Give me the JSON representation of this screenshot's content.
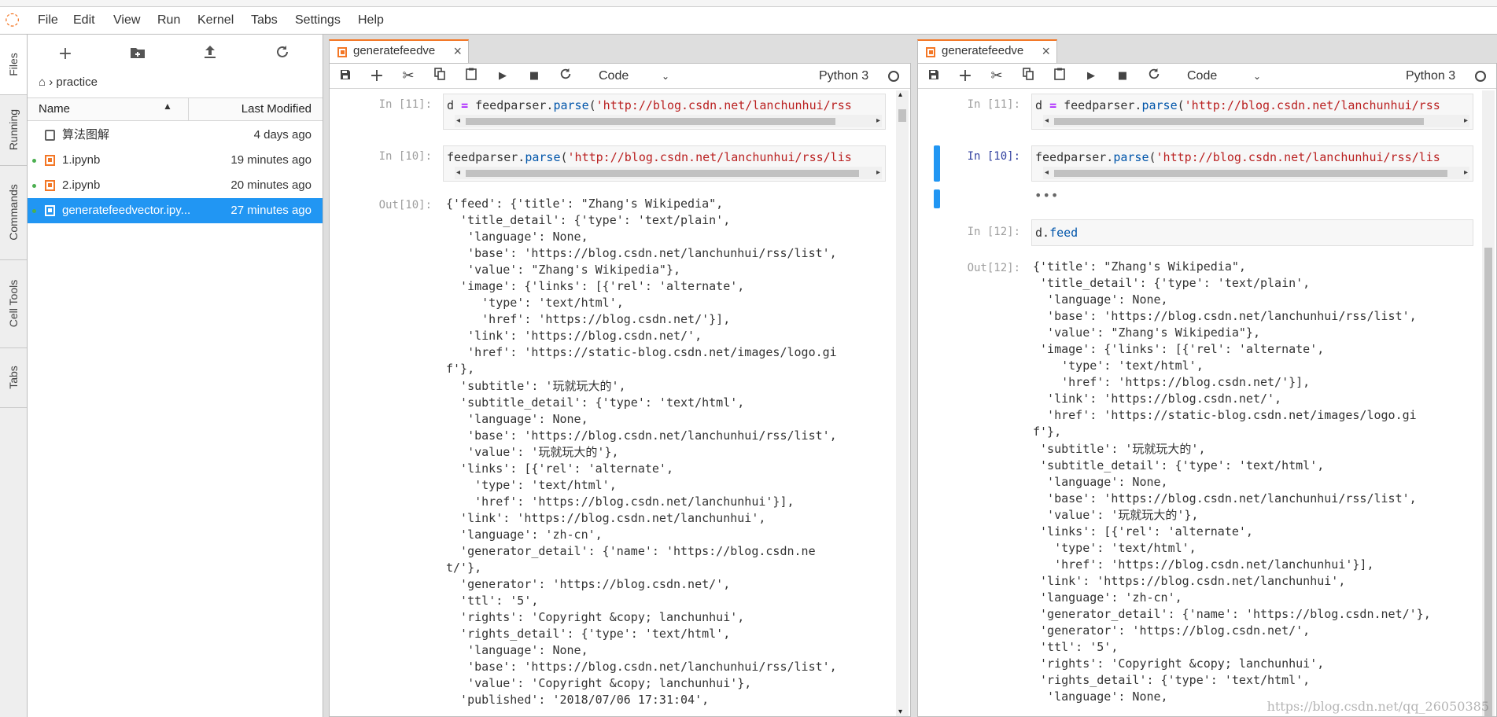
{
  "menubar": {
    "items": [
      "File",
      "Edit",
      "View",
      "Run",
      "Kernel",
      "Tabs",
      "Settings",
      "Help"
    ]
  },
  "left_tabs": [
    "Files",
    "Running",
    "Commands",
    "Cell Tools",
    "Tabs"
  ],
  "filebrowser": {
    "breadcrumb": "practice",
    "col_name": "Name",
    "col_modified": "Last Modified",
    "files": [
      {
        "name": "算法图解",
        "modified": "4 days ago",
        "type": "folder",
        "running": false,
        "selected": false
      },
      {
        "name": "1.ipynb",
        "modified": "19 minutes ago",
        "type": "notebook",
        "running": true,
        "selected": false
      },
      {
        "name": "2.ipynb",
        "modified": "20 minutes ago",
        "type": "notebook",
        "running": true,
        "selected": false
      },
      {
        "name": "generatefeedvector.ipy...",
        "modified": "27 minutes ago",
        "type": "notebook",
        "running": true,
        "selected": true
      }
    ]
  },
  "notebooks": [
    {
      "tab_label": "generatefeedve",
      "cell_type": "Code",
      "kernel": "Python 3",
      "cells": [
        {
          "prompt": "In [11]:",
          "code_parts": [
            "d ",
            "=",
            " feedparser.",
            "parse",
            "(",
            "'http://blog.csdn.net/lanchunhui/rss"
          ]
        },
        {
          "prompt": "In [10]:",
          "code_parts": [
            "feedparser.",
            "parse",
            "(",
            "'http://blog.csdn.net/lanchunhui/rss/lis"
          ]
        }
      ],
      "out_prompt": "Out[10]:",
      "output": "{'feed': {'title': \"Zhang's Wikipedia\",\n  'title_detail': {'type': 'text/plain',\n   'language': None,\n   'base': 'https://blog.csdn.net/lanchunhui/rss/list',\n   'value': \"Zhang's Wikipedia\"},\n  'image': {'links': [{'rel': 'alternate',\n     'type': 'text/html',\n     'href': 'https://blog.csdn.net/'}],\n   'link': 'https://blog.csdn.net/',\n   'href': 'https://static-blog.csdn.net/images/logo.gi\nf'},\n  'subtitle': '玩就玩大的',\n  'subtitle_detail': {'type': 'text/html',\n   'language': None,\n   'base': 'https://blog.csdn.net/lanchunhui/rss/list',\n   'value': '玩就玩大的'},\n  'links': [{'rel': 'alternate',\n    'type': 'text/html',\n    'href': 'https://blog.csdn.net/lanchunhui'}],\n  'link': 'https://blog.csdn.net/lanchunhui',\n  'language': 'zh-cn',\n  'generator_detail': {'name': 'https://blog.csdn.ne\nt/'},\n  'generator': 'https://blog.csdn.net/',\n  'ttl': '5',\n  'rights': 'Copyright &copy; lanchunhui',\n  'rights_detail': {'type': 'text/html',\n   'language': None,\n   'base': 'https://blog.csdn.net/lanchunhui/rss/list',\n   'value': 'Copyright &copy; lanchunhui'},\n  'published': '2018/07/06 17:31:04',"
    },
    {
      "tab_label": "generatefeedve",
      "cell_type": "Code",
      "kernel": "Python 3",
      "cells": [
        {
          "prompt": "In [11]:",
          "code_parts": [
            "d ",
            "=",
            " feedparser.",
            "parse",
            "(",
            "'http://blog.csdn.net/lanchunhui/rss"
          ]
        },
        {
          "prompt": "In [10]:",
          "code_parts": [
            "feedparser.",
            "parse",
            "(",
            "'http://blog.csdn.net/lanchunhui/rss/lis"
          ]
        },
        {
          "prompt": "In [12]:",
          "code_parts": [
            "d.",
            "feed"
          ]
        }
      ],
      "collapsed_marker": "•••",
      "out_prompt": "Out[12]:",
      "output": "{'title': \"Zhang's Wikipedia\",\n 'title_detail': {'type': 'text/plain',\n  'language': None,\n  'base': 'https://blog.csdn.net/lanchunhui/rss/list',\n  'value': \"Zhang's Wikipedia\"},\n 'image': {'links': [{'rel': 'alternate',\n    'type': 'text/html',\n    'href': 'https://blog.csdn.net/'}],\n  'link': 'https://blog.csdn.net/',\n  'href': 'https://static-blog.csdn.net/images/logo.gi\nf'},\n 'subtitle': '玩就玩大的',\n 'subtitle_detail': {'type': 'text/html',\n  'language': None,\n  'base': 'https://blog.csdn.net/lanchunhui/rss/list',\n  'value': '玩就玩大的'},\n 'links': [{'rel': 'alternate',\n   'type': 'text/html',\n   'href': 'https://blog.csdn.net/lanchunhui'}],\n 'link': 'https://blog.csdn.net/lanchunhui',\n 'language': 'zh-cn',\n 'generator_detail': {'name': 'https://blog.csdn.net/'},\n 'generator': 'https://blog.csdn.net/',\n 'ttl': '5',\n 'rights': 'Copyright &copy; lanchunhui',\n 'rights_detail': {'type': 'text/html',\n  'language': None,"
    }
  ],
  "watermark": "https://blog.csdn.net/qq_26050385",
  "colors": {
    "accent": "#f37726",
    "selection": "#2196f3",
    "running_dot": "#4caf50"
  }
}
